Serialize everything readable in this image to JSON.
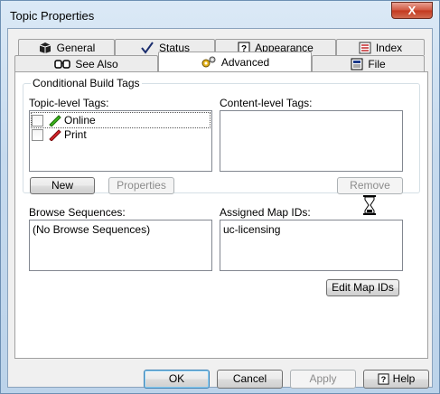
{
  "window": {
    "title": "Topic Properties",
    "close_glyph": "X"
  },
  "tabs_row1": [
    {
      "label": "General",
      "icon": "cube-icon"
    },
    {
      "label": "Status",
      "icon": "checkmark-icon"
    },
    {
      "label": "Appearance",
      "icon": "help-icon"
    },
    {
      "label": "Index",
      "icon": "index-icon"
    }
  ],
  "tabs_row2": [
    {
      "label": "See Also",
      "icon": "glasses-icon"
    },
    {
      "label": "Advanced",
      "icon": "gears-icon"
    },
    {
      "label": "File",
      "icon": "file-icon"
    }
  ],
  "conditional": {
    "group_label": "Conditional Build Tags",
    "topic_tags_label": "Topic-level Tags:",
    "content_tags_label": "Content-level Tags:",
    "tags": [
      {
        "label": "Online",
        "color": "#3cb81c",
        "checked": false
      },
      {
        "label": "Print",
        "color": "#d8242a",
        "checked": false
      }
    ],
    "new_label": "New",
    "properties_label": "Properties",
    "remove_label": "Remove"
  },
  "browse": {
    "label": "Browse Sequences:",
    "value": "(No Browse Sequences)"
  },
  "mapids": {
    "label": "Assigned Map IDs:",
    "value": "uc-licensing",
    "edit_label": "Edit Map IDs"
  },
  "footer": {
    "ok": "OK",
    "cancel": "Cancel",
    "apply": "Apply",
    "help": "Help"
  }
}
